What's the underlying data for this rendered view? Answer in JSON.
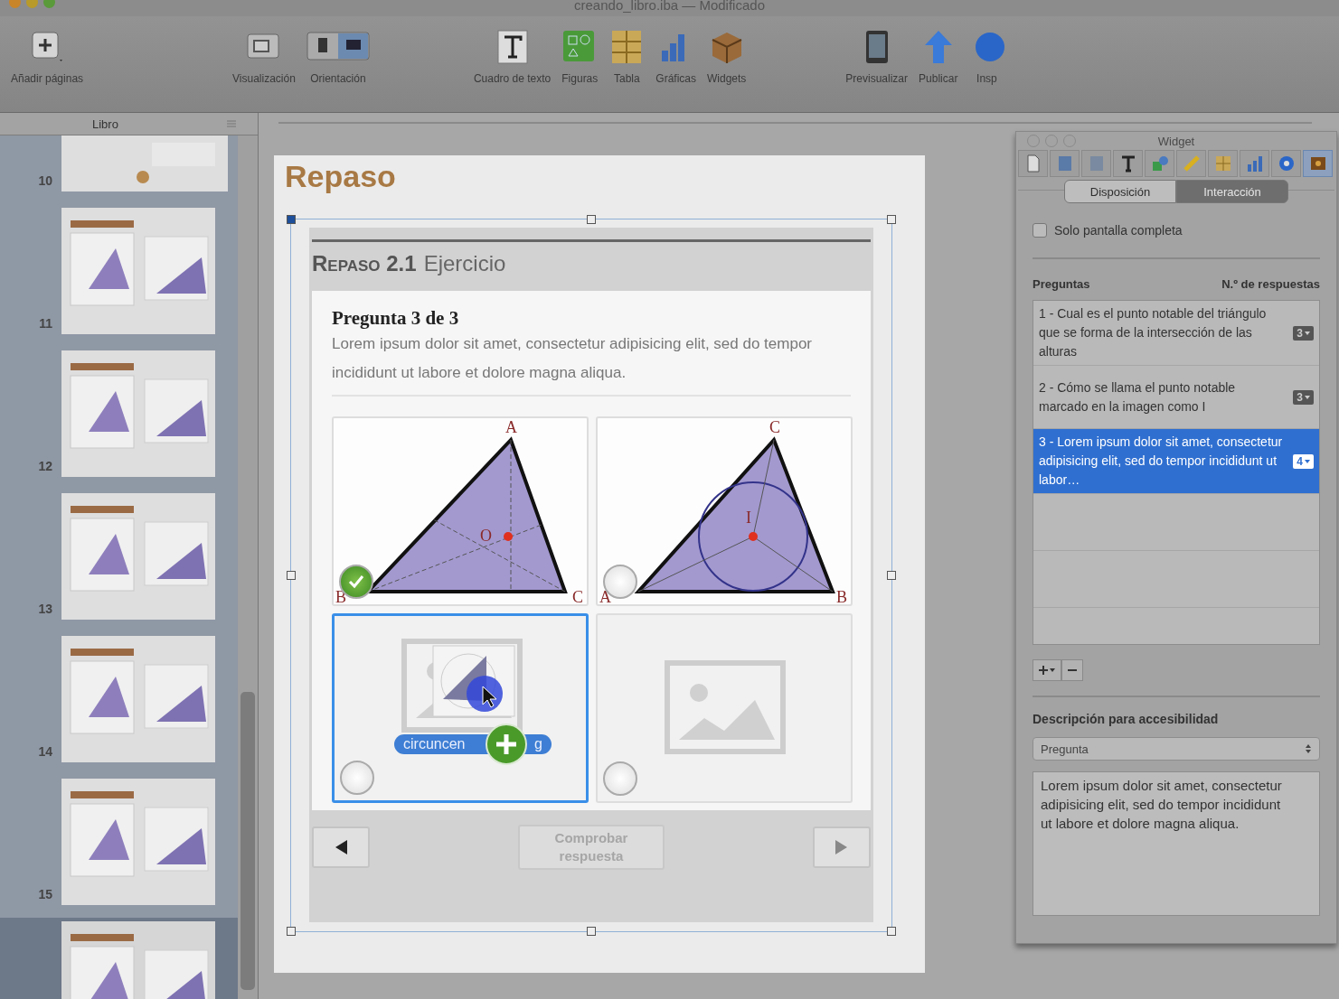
{
  "window": {
    "title": "creando_libro.iba — Modificado"
  },
  "toolbar": {
    "groups": [
      {
        "items": [
          {
            "label": "Añadir páginas"
          }
        ]
      },
      {
        "items": [
          {
            "label": "Visualización"
          },
          {
            "label": "Orientación"
          }
        ]
      },
      {
        "items": [
          {
            "label": "Cuadro de texto"
          },
          {
            "label": "Figuras"
          },
          {
            "label": "Tabla"
          },
          {
            "label": "Gráficas"
          },
          {
            "label": "Widgets"
          }
        ]
      },
      {
        "items": [
          {
            "label": "Previsualizar"
          },
          {
            "label": "Publicar"
          },
          {
            "label": "Insp"
          }
        ]
      }
    ]
  },
  "sidebar": {
    "title": "Libro",
    "pages": [
      {
        "number": "10",
        "kind": "single",
        "selected": false
      },
      {
        "number": "11",
        "kind": "spread",
        "selected": false
      },
      {
        "number": "12",
        "kind": "spread",
        "selected": false
      },
      {
        "number": "13",
        "kind": "spread",
        "selected": false
      },
      {
        "number": "14",
        "kind": "spread",
        "selected": false
      },
      {
        "number": "15",
        "kind": "spread",
        "selected": false
      },
      {
        "kind": "spread",
        "selected": true
      }
    ]
  },
  "page": {
    "title": "Repaso",
    "widget": {
      "label": "Repaso 2.1",
      "caption": "Ejercicio",
      "question_title": "Pregunta 3 de 3",
      "question_text": "Lorem ipsum dolor sit amet, consectetur adipisicing elit, sed do tempor incididunt ut labore et dolore magna aliqua.",
      "answers": [
        {
          "kind": "figure",
          "labels": [
            "A",
            "O",
            "B",
            "C"
          ],
          "correct": true,
          "selected": false
        },
        {
          "kind": "figure",
          "labels": [
            "C",
            "I",
            "A",
            "B"
          ],
          "correct": false,
          "selected": false
        },
        {
          "kind": "drop",
          "drag_label": "circuncen",
          "drag_label_end": "g",
          "correct": false,
          "selected": true
        },
        {
          "kind": "placeholder",
          "correct": false,
          "selected": false
        }
      ],
      "check_button": {
        "label": "Comprobar respuesta",
        "disabled": true
      }
    }
  },
  "inspector": {
    "title": "Widget",
    "tools": [
      {
        "selected": false
      },
      {
        "selected": false
      },
      {
        "selected": false
      },
      {
        "selected": false
      },
      {
        "selected": false
      },
      {
        "selected": false
      },
      {
        "selected": false
      },
      {
        "selected": false
      },
      {
        "selected": false
      },
      {
        "selected": true
      }
    ],
    "tabs": [
      {
        "label": "Disposición",
        "selected": false
      },
      {
        "label": "Interacción",
        "selected": true
      }
    ],
    "fullscreen_only": {
      "label": "Solo pantalla completa",
      "checked": false
    },
    "questions_header": "Preguntas",
    "answers_header": "N.º de respuestas",
    "questions": [
      {
        "text": "1 - Cual es el punto notable del triángulo que se forma de la intersección de las alturas",
        "count": "3",
        "selected": false
      },
      {
        "text": "2 - Cómo se llama el punto notable marcado en la imagen como I",
        "count": "3",
        "selected": false
      },
      {
        "text": "3 - Lorem ipsum dolor sit amet, consectetur adipisicing elit, sed do tempor incididunt ut labor…",
        "count": "4",
        "selected": true
      }
    ],
    "accessibility_label": "Descripción para accesibilidad",
    "accessibility_select": "Pregunta",
    "accessibility_text": "Lorem ipsum dolor sit amet, consectetur adipisicing elit, sed do tempor incididunt ut labore et dolore magna aliqua."
  }
}
